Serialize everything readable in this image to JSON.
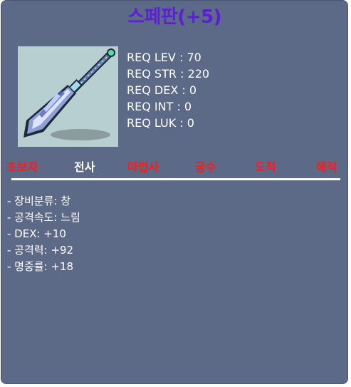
{
  "item": {
    "name": "스페판(+5)",
    "icon": "spear-icon"
  },
  "requirements": [
    "REQ LEV : 70",
    "REQ STR : 220",
    "REQ DEX : 0",
    "REQ INT : 0",
    "REQ LUK : 0"
  ],
  "classes": [
    {
      "label": "초보자",
      "available": false
    },
    {
      "label": "전사",
      "available": true
    },
    {
      "label": "마법사",
      "available": false
    },
    {
      "label": "궁수",
      "available": false
    },
    {
      "label": "도적",
      "available": false
    },
    {
      "label": "해적",
      "available": false
    }
  ],
  "stats": [
    "- 장비분류: 창",
    "- 공격속도: 느림",
    "- DEX: +10",
    "- 공격력: +92",
    "- 명중률: +18"
  ],
  "colors": {
    "background": "#5d6a87",
    "title": "#5c1fd6",
    "available_class": "#ffffff",
    "unavailable_class": "#ff1a1a"
  }
}
